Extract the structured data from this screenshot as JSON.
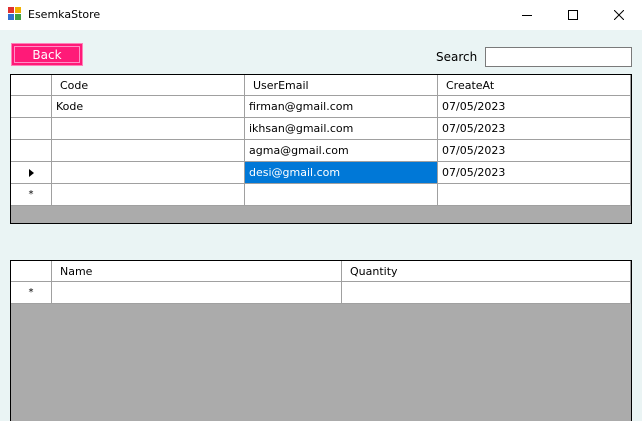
{
  "window": {
    "title": "EsemkaStore"
  },
  "toolbar": {
    "back_label": "Back",
    "search_label": "Search",
    "search_value": ""
  },
  "orders": {
    "columns": [
      "Code",
      "UserEmail",
      "CreateAt"
    ],
    "rows": [
      {
        "code": "Kode",
        "email": "firman@gmail.com",
        "date": "07/05/2023"
      },
      {
        "code": "",
        "email": "ikhsan@gmail.com",
        "date": "07/05/2023"
      },
      {
        "code": "",
        "email": "agma@gmail.com",
        "date": "07/05/2023"
      },
      {
        "code": "",
        "email": "desi@gmail.com",
        "date": "07/05/2023"
      }
    ],
    "new_row_marker": "*"
  },
  "details": {
    "columns": [
      "Name",
      "Quantity"
    ],
    "new_row_marker": "*"
  },
  "colors": {
    "back_button": "#ff1a78",
    "selection": "#0078d7",
    "client_bg": "#eaf4f4",
    "grid_empty": "#ababab"
  }
}
